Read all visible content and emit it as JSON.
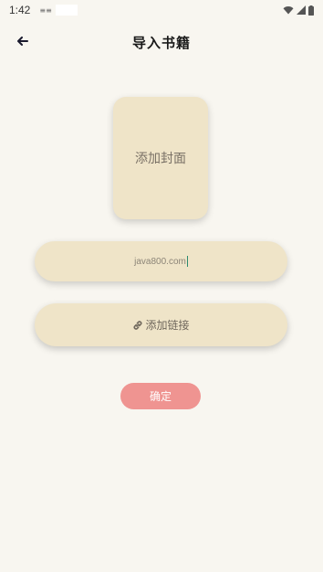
{
  "status_bar": {
    "time": "1:42",
    "notification_text": "≡≡"
  },
  "header": {
    "title": "导入书籍"
  },
  "cover": {
    "label": "添加封面"
  },
  "url_field": {
    "value": "java800.com"
  },
  "link_button": {
    "label": "添加链接"
  },
  "confirm_button": {
    "label": "确定"
  },
  "colors": {
    "background": "#f8f6f0",
    "card": "#efe4c8",
    "confirm": "#ef9491"
  }
}
